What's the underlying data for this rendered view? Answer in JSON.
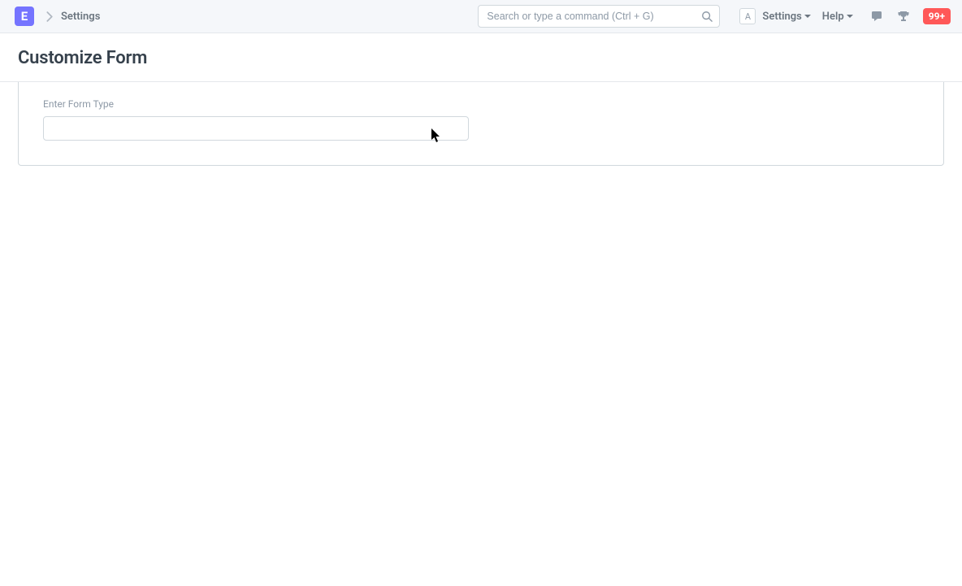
{
  "brand": {
    "letter": "E"
  },
  "breadcrumb": {
    "item": "Settings"
  },
  "search": {
    "placeholder": "Search or type a command (Ctrl + G)",
    "value": ""
  },
  "kbd": {
    "letter": "A"
  },
  "nav": {
    "settings_label": "Settings",
    "help_label": "Help"
  },
  "badge": {
    "text": "99+"
  },
  "page": {
    "title": "Customize Form"
  },
  "form": {
    "form_type_label": "Enter Form Type",
    "form_type_value": ""
  }
}
